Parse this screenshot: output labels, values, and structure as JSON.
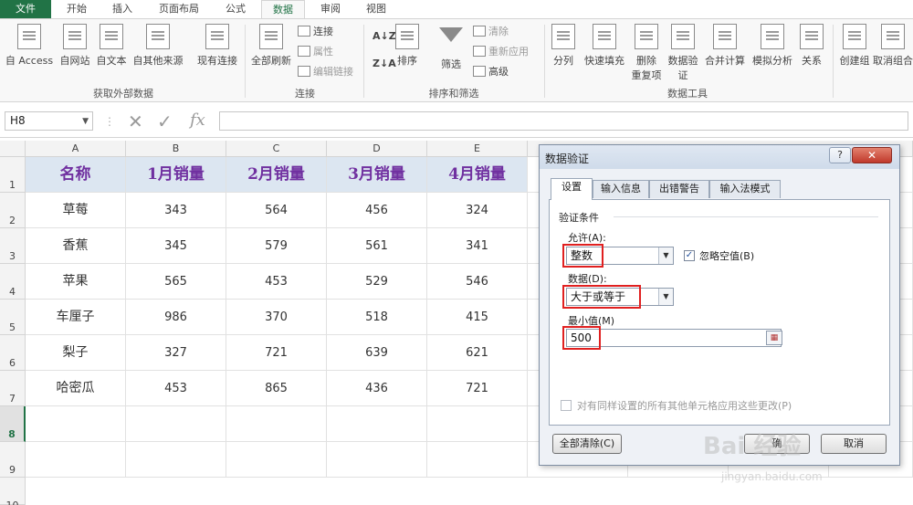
{
  "ribbon": {
    "tabs": [
      "文件",
      "开始",
      "插入",
      "页面布局",
      "公式",
      "数据",
      "审阅",
      "视图"
    ],
    "active_tab": "数据",
    "groups": {
      "external": {
        "label": "获取外部数据",
        "buttons": [
          "自 Access",
          "自网站",
          "自文本",
          "自其他来源",
          "现有连接"
        ]
      },
      "connections": {
        "label": "连接",
        "refresh": "全部刷新",
        "small": [
          "连接",
          "属性",
          "编辑链接"
        ]
      },
      "sort_filter": {
        "label": "排序和筛选",
        "sort": "排序",
        "filter": "筛选",
        "small": [
          "清除",
          "重新应用",
          "高级"
        ]
      },
      "data_tools": {
        "label": "数据工具",
        "buttons": [
          "分列",
          "快速填充",
          "删除",
          "重复项",
          "数据验",
          "证",
          "合并计算",
          "模拟分析",
          "关系"
        ]
      },
      "outline": {
        "buttons": [
          "创建组",
          "取消组合"
        ]
      }
    }
  },
  "formula_bar": {
    "name_box": "H8",
    "fx_label": "fx"
  },
  "sheet": {
    "columns": [
      "A",
      "B",
      "C",
      "D",
      "E"
    ],
    "rows": [
      "1",
      "2",
      "3",
      "4",
      "5",
      "6",
      "7",
      "8",
      "9",
      "10"
    ],
    "header": [
      "名称",
      "1月销量",
      "2月销量",
      "3月销量",
      "4月销量"
    ],
    "data": [
      [
        "草莓",
        "343",
        "564",
        "456",
        "324"
      ],
      [
        "香蕉",
        "345",
        "579",
        "561",
        "341"
      ],
      [
        "苹果",
        "565",
        "453",
        "529",
        "546"
      ],
      [
        "车厘子",
        "986",
        "370",
        "518",
        "415"
      ],
      [
        "梨子",
        "327",
        "721",
        "639",
        "621"
      ],
      [
        "哈密瓜",
        "453",
        "865",
        "436",
        "721"
      ]
    ],
    "selected_row": "8"
  },
  "dialog": {
    "title": "数据验证",
    "help": "?",
    "close": "✕",
    "tabs": [
      "设置",
      "输入信息",
      "出错警告",
      "输入法模式"
    ],
    "active_tab": "设置",
    "section": "验证条件",
    "allow_label": "允许(A):",
    "allow_value": "整数",
    "ignore_blank": "忽略空值(B)",
    "data_label": "数据(D):",
    "data_value": "大于或等于",
    "min_label": "最小值(M)",
    "min_value": "500",
    "apply_all": "对有同样设置的所有其他单元格应用这些更改(P)",
    "clear_all": "全部清除(C)",
    "ok": "确",
    "cancel": "取消"
  },
  "watermark": {
    "main": "Bai 经验",
    "sub": "jingyan.baidu.com"
  },
  "colors": {
    "excel_green": "#217346",
    "header_fill": "#dce6f1",
    "header_text": "#7030a0",
    "highlight": "#e02020"
  }
}
